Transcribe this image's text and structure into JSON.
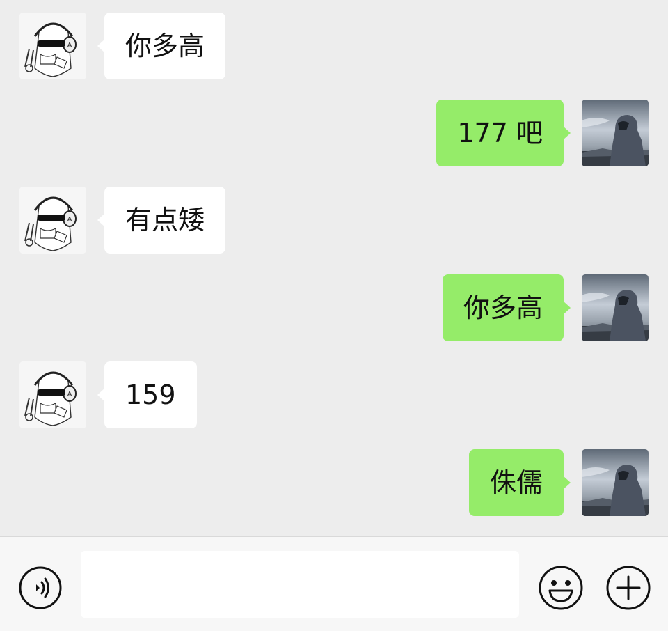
{
  "messages": [
    {
      "side": "left",
      "text": "你多高",
      "avatar": "anime-girl-headphones-sunglasses"
    },
    {
      "side": "right",
      "text": "177 吧",
      "avatar": "hooded-person-by-sea"
    },
    {
      "side": "left",
      "text": "有点矮",
      "avatar": "anime-girl-headphones-sunglasses"
    },
    {
      "side": "right",
      "text": "你多高",
      "avatar": "hooded-person-by-sea"
    },
    {
      "side": "left",
      "text": "159",
      "avatar": "anime-girl-headphones-sunglasses"
    },
    {
      "side": "right",
      "text": "侏儒",
      "avatar": "hooded-person-by-sea"
    }
  ],
  "input_bar": {
    "text_value": "",
    "icons": {
      "voice": "voice-icon",
      "emoji": "emoji-icon",
      "plus": "plus-icon"
    }
  },
  "colors": {
    "chat_background": "#ededed",
    "incoming_bubble": "#ffffff",
    "outgoing_bubble": "#95ec69",
    "input_bar_background": "#f7f7f7"
  }
}
